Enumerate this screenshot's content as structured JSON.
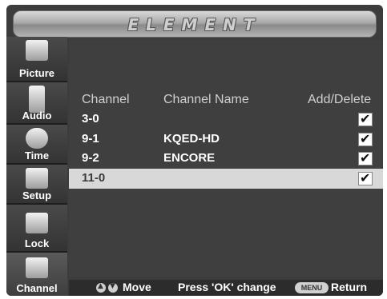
{
  "brand": "ELEMENT",
  "sidebar": {
    "items": [
      {
        "label": "Picture",
        "icon": "picture-icon"
      },
      {
        "label": "Audio",
        "icon": "speaker-icon"
      },
      {
        "label": "Time",
        "icon": "clock-icon"
      },
      {
        "label": "Setup",
        "icon": "tools-icon"
      },
      {
        "label": "Lock",
        "icon": "lock-icon"
      },
      {
        "label": "Channel",
        "icon": "tv-icon"
      }
    ],
    "active": "Channel"
  },
  "table": {
    "headers": {
      "channel": "Channel",
      "name": "Channel Name",
      "add": "Add/Delete"
    },
    "rows": [
      {
        "channel": "3-0",
        "name": "",
        "added": true
      },
      {
        "channel": "9-1",
        "name": "KQED-HD",
        "added": true
      },
      {
        "channel": "9-2",
        "name": "ENCORE",
        "added": true
      },
      {
        "channel": "11-0",
        "name": "",
        "added": true
      }
    ],
    "selected_row": 3
  },
  "footer": {
    "move": "Move",
    "change": "Press 'OK' change",
    "menu_key": "MENU",
    "return": "Return"
  },
  "check_glyph": "✔"
}
